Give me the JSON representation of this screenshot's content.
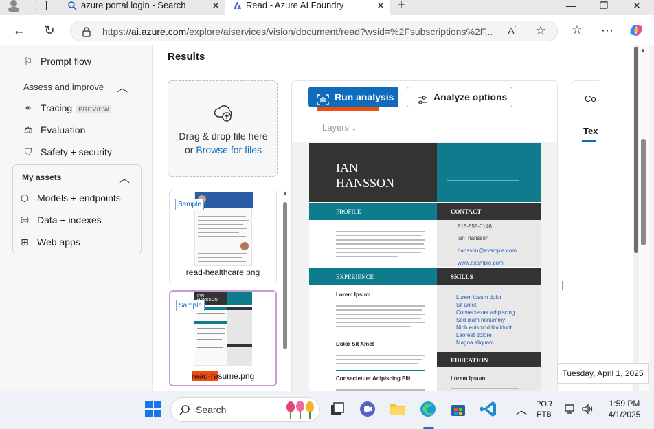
{
  "tabs": [
    {
      "title": "azure portal login - Search",
      "icon": "search-icon"
    },
    {
      "title": "Read - Azure AI Foundry",
      "icon": "azure-ai-icon",
      "active": true
    }
  ],
  "address": {
    "url_prefix": "https://",
    "url_domain": "ai.azure.com",
    "url_rest": "/explore/aiservices/vision/document/read?wsid=%2Fsubscriptions%2F..."
  },
  "sidebar": {
    "prompt_flow": "Prompt flow",
    "assess_title": "Assess and improve",
    "tracing": "Tracing",
    "tracing_badge": "PREVIEW",
    "evaluation": "Evaluation",
    "safety": "Safety + security",
    "assets_title": "My assets",
    "models": "Models + endpoints",
    "data": "Data + indexes",
    "webapps": "Web apps"
  },
  "main": {
    "results_title": "Results",
    "drop_text": "Drag & drop file here",
    "drop_or": "or",
    "browse": "Browse for files",
    "samples": [
      {
        "badge": "Sample",
        "name": "read-healthcare.png"
      },
      {
        "badge": "Sample",
        "name": "read-resume.png"
      }
    ],
    "run_analysis": "Run analysis",
    "analyze_options": "Analyze options",
    "layers": "Layers",
    "right_tab_1": "Co",
    "right_tab_2": "Tex"
  },
  "resume": {
    "first_name": "IAN",
    "last_name": "HANSSON",
    "profile": "PROFILE",
    "contact": "CONTACT",
    "phone": "816-555-0146",
    "handle": "ian_hansson",
    "email": "hansson@example.com",
    "website": "www.example.com",
    "experience": "EXPERIENCE",
    "skills": "SKILLS",
    "job1": "Lorem Ipsum",
    "job2": "Dolor Sit Amet",
    "job3": "Consectetuer Adipiscing Elit",
    "skill_items": [
      "Lorem ipsum dolor",
      "Sit amet",
      "Consectetuer adipiscing",
      "Sed diam nonummy",
      "Nibh euismod tincidunt",
      "Laoreet dolore",
      "Magna aliquam"
    ],
    "education": "EDUCATION",
    "edu1": "Lorem Ipsum"
  },
  "tooltip": {
    "date": "Tuesday, April 1, 2025"
  },
  "taskbar": {
    "search": "Search",
    "lang_1": "POR",
    "lang_2": "PTB",
    "time": "1:59 PM",
    "date": "4/1/2025"
  },
  "colors": {
    "accent": "#0f6cbd",
    "teal": "#0e7c8c",
    "dark": "#333333",
    "highlight": "#f04e0e"
  }
}
